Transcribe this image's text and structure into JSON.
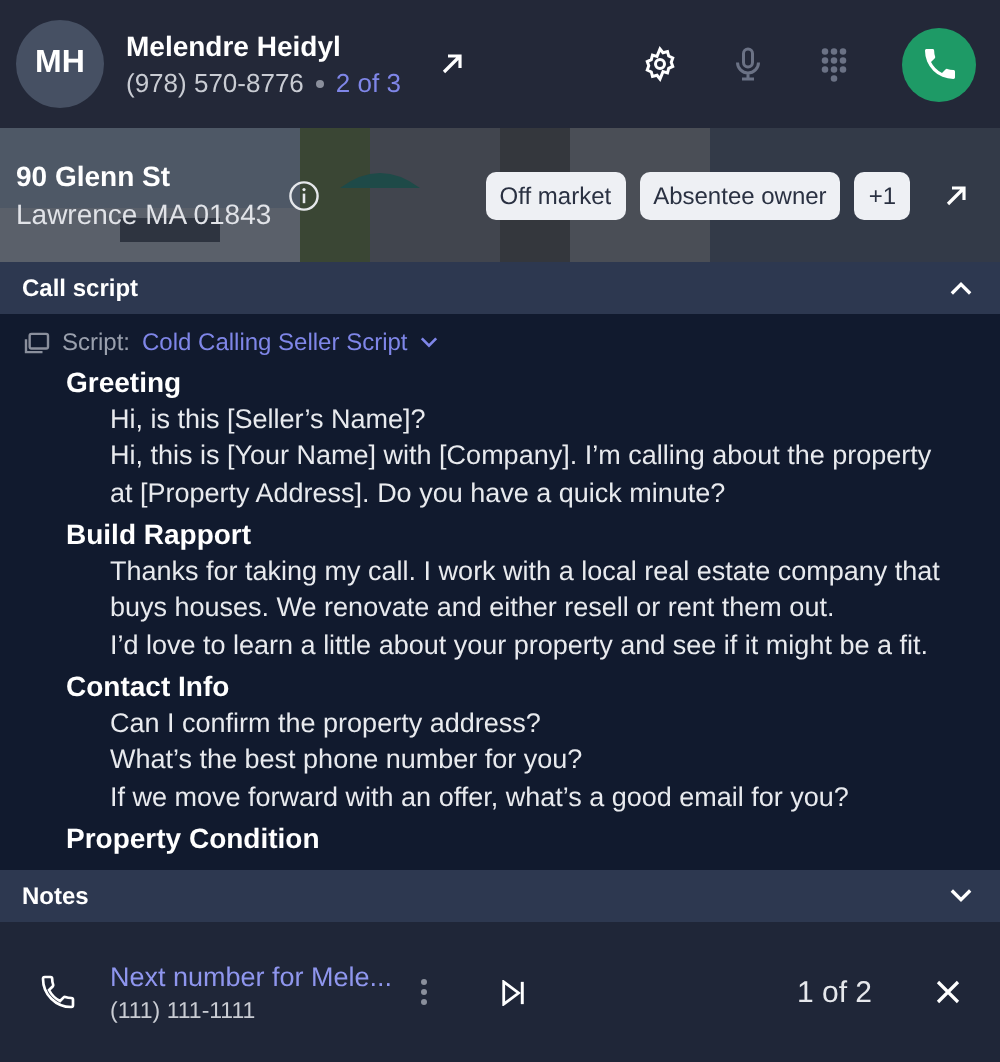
{
  "contact": {
    "initials": "MH",
    "name": "Melendre Heidyl",
    "phone": "(978) 570-8776",
    "position": "2 of 3"
  },
  "property": {
    "street": "90 Glenn St",
    "city": "Lawrence MA 01843",
    "tags": [
      "Off market",
      "Absentee owner",
      "+1"
    ]
  },
  "call_script": {
    "title": "Call script",
    "expanded": true,
    "script_label": "Script:",
    "script_name": "Cold Calling Seller Script",
    "sections": [
      {
        "heading": "Greeting",
        "lines": [
          "Hi, is this [Seller’s Name]?",
          "Hi, this is [Your Name] with [Company]. I’m calling about the property at [Property Address]. Do you have a quick minute?"
        ]
      },
      {
        "heading": "Build Rapport",
        "lines": [
          "Thanks for taking my call. I work with a local real estate company that buys houses. We renovate and either resell or rent them out.",
          "I’d love to learn a little about your property and see if it might be a fit."
        ]
      },
      {
        "heading": "Contact Info",
        "lines": [
          "Can I confirm the property address?",
          "What’s the best phone number for you?",
          "If we move forward with an offer, what’s a good email for you?"
        ]
      },
      {
        "heading": "Property Condition"
      }
    ]
  },
  "notes": {
    "title": "Notes",
    "expanded": false
  },
  "next_call": {
    "label": "Next number for Mele...",
    "phone": "(111) 111-1111",
    "count": "1 of 2"
  }
}
